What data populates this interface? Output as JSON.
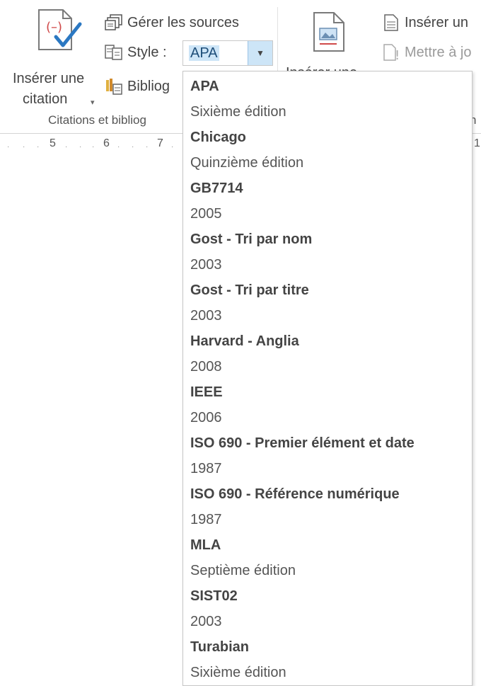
{
  "ribbon": {
    "insert_citation": {
      "label_line1": "Insérer une",
      "label_line2": "citation"
    },
    "manage_sources": "Gérer les sources",
    "style_label": "Style :",
    "style_value": "APA",
    "bibliography": "Bibliog",
    "citations_group": "Citations et bibliog",
    "insert_caption": "Insérer une",
    "insert_right_top": "Insérer un",
    "update_table": "Mettre à jo",
    "right_group_label": "n"
  },
  "ruler": {
    "marks": [
      "5",
      "6",
      "7",
      "1"
    ]
  },
  "style_dropdown": {
    "items": [
      {
        "name": "APA",
        "edition": "Sixième édition"
      },
      {
        "name": "Chicago",
        "edition": "Quinzième édition"
      },
      {
        "name": "GB7714",
        "edition": "2005"
      },
      {
        "name": "Gost - Tri par nom",
        "edition": "2003"
      },
      {
        "name": "Gost - Tri par titre",
        "edition": "2003"
      },
      {
        "name": "Harvard - Anglia",
        "edition": "2008"
      },
      {
        "name": "IEEE",
        "edition": "2006"
      },
      {
        "name": "ISO 690 - Premier élément et date",
        "edition": "1987"
      },
      {
        "name": "ISO 690 - Référence numérique",
        "edition": "1987"
      },
      {
        "name": "MLA",
        "edition": "Septième édition"
      },
      {
        "name": "SIST02",
        "edition": "2003"
      },
      {
        "name": "Turabian",
        "edition": "Sixième édition"
      }
    ]
  },
  "colors": {
    "accent": "#2b78c2",
    "selection": "#cde5f7",
    "text": "#444444"
  }
}
